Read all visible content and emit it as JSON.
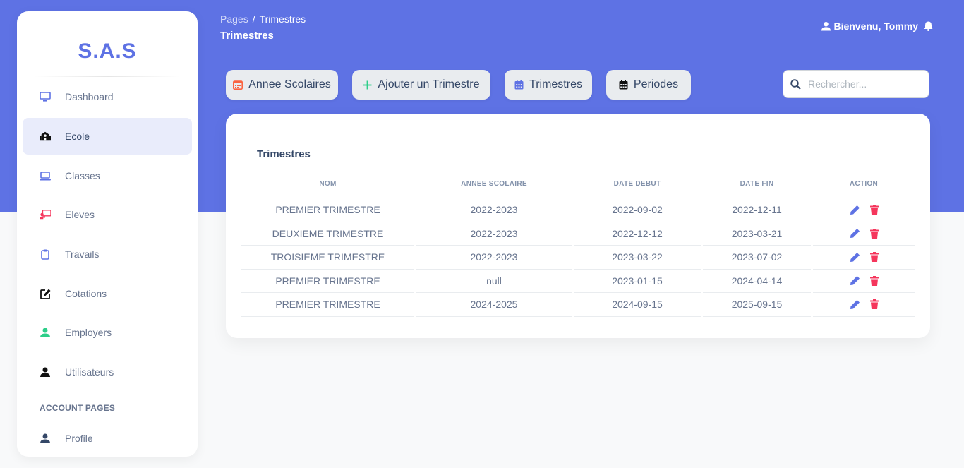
{
  "brand": "S.A.S",
  "sidebar": {
    "items": [
      {
        "label": "Dashboard",
        "icon": "monitor-icon"
      },
      {
        "label": "Ecole",
        "icon": "school-icon"
      },
      {
        "label": "Classes",
        "icon": "laptop-icon"
      },
      {
        "label": "Eleves",
        "icon": "chalkboard-teacher-icon"
      },
      {
        "label": "Travails",
        "icon": "clipboard-icon"
      },
      {
        "label": "Cotations",
        "icon": "edit-icon"
      },
      {
        "label": "Employers",
        "icon": "user-icon"
      },
      {
        "label": "Utilisateurs",
        "icon": "user-icon"
      }
    ],
    "section_title": "ACCOUNT PAGES",
    "account_items": [
      {
        "label": "Profile",
        "icon": "user-icon"
      }
    ],
    "active": "Ecole"
  },
  "header": {
    "breadcrumb_root": "Pages",
    "breadcrumb_sep": "/",
    "breadcrumb_current": "Trimestres",
    "title": "Trimestres",
    "user_greeting": "Bienvenu, Tommy"
  },
  "toolbar": {
    "annees_label": "Annee Scolaires",
    "ajouter_label": "Ajouter un Trimestre",
    "trimestres_label": "Trimestres",
    "periodes_label": "Periodes"
  },
  "search": {
    "placeholder": "Rechercher..."
  },
  "card": {
    "title": "Trimestres",
    "columns": [
      "NOM",
      "ANNEE SCOLAIRE",
      "DATE DEBUT",
      "DATE FIN",
      "ACTION"
    ],
    "rows": [
      [
        "PREMIER TRIMESTRE",
        "2022-2023",
        "2022-09-02",
        "2022-12-11"
      ],
      [
        "DEUXIEME TRIMESTRE",
        "2022-2023",
        "2022-12-12",
        "2023-03-21"
      ],
      [
        "TROISIEME TRIMESTRE",
        "2022-2023",
        "2023-03-22",
        "2023-07-02"
      ],
      [
        "PREMIER TRIMESTRE",
        "null",
        "2023-01-15",
        "2024-04-14"
      ],
      [
        "PREMIER TRIMESTRE",
        "2024-2025",
        "2024-09-15",
        "2025-09-15"
      ]
    ]
  },
  "colors": {
    "primary": "#5e72e4",
    "danger": "#f5365c",
    "success": "#2dce89",
    "orange": "#fb6340"
  }
}
